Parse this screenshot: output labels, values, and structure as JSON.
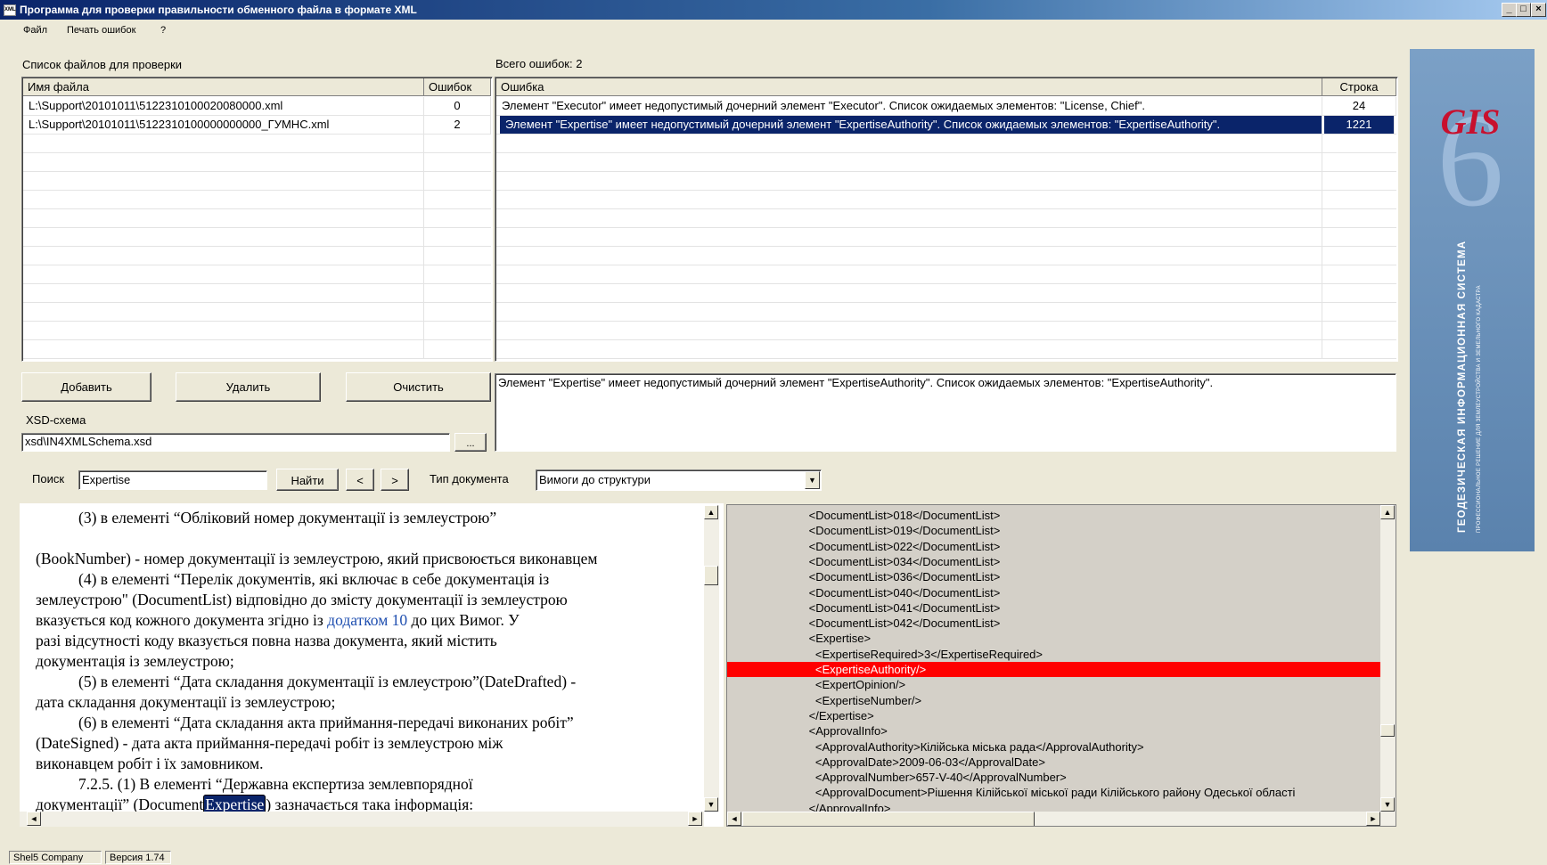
{
  "window": {
    "title": "Программа для проверки правильности обменного файла в формате XML",
    "icon_text": "XML",
    "controls": [
      "_",
      "□",
      "×"
    ]
  },
  "menu": [
    "Файл",
    "Печать ошибок",
    "?"
  ],
  "files_panel": {
    "label": "Список файлов для проверки",
    "columns": [
      "Имя файла",
      "Ошибок"
    ],
    "rows": [
      {
        "name": "L:\\Support\\20101011\\5122310100020080000.xml",
        "errors": "0"
      },
      {
        "name": "L:\\Support\\20101011\\5122310100000000000_ГУМНС.xml",
        "errors": "2"
      }
    ]
  },
  "errors_panel": {
    "label": "Всего ошибок: 2",
    "columns": [
      "Ошибка",
      "Строка"
    ],
    "rows": [
      {
        "message": "Элемент \"Executor\" имеет недопустимый дочерний элемент \"Executor\". Список ожидаемых элементов: \"License, Chief\".",
        "line": "24"
      },
      {
        "message": "Элемент \"Expertise\" имеет недопустимый дочерний элемент \"ExpertiseAuthority\". Список ожидаемых элементов: \"ExpertiseAuthority\".",
        "line": "1221"
      }
    ],
    "selected_index": 1
  },
  "buttons": {
    "add": "Добавить",
    "delete": "Удалить",
    "clear": "Очистить"
  },
  "error_detail": "Элемент \"Expertise\" имеет недопустимый дочерний элемент \"ExpertiseAuthority\". Список ожидаемых элементов: \"ExpertiseAuthority\".",
  "xsd": {
    "label": "XSD-схема",
    "value": "xsd\\IN4XMLSchema.xsd",
    "browse": "..."
  },
  "search": {
    "label": "Поиск",
    "value": "Expertise",
    "find_button": "Найти",
    "prev": "<",
    "next": ">",
    "doctype_label": "Тип документа",
    "doctype_value": "Вимоги до структури"
  },
  "document_text": {
    "l1": "(3) в елементі  “Обліковий  номер  документації  із  землеустрою”",
    "l2": "(BookNumber)   -   номер документації із землеустрою, який присвоюється виконавцем",
    "l3": "(4)  в  елементі  “Перелік  документів,  які  включає  в  себе  документація  із",
    "l4": "землеустрою\" (DocumentList) відповідно до змісту документації  із  землеустрою",
    "l5a": "вказується код кожного документа згідно із ",
    "l5link": "додатком 10",
    "l5b": "  до  цих  Вимог.  У",
    "l6": "разі   відсутності    коду    вказується   повна   назва   документа,    який   містить",
    "l7": "документація із землеустрою;",
    "l8": "(5) в елементі  “Дата  складання  документації  із  емлеустрою”(DateDrafted) -",
    "l9": "дата складання документації із землеустрою;",
    "l10": "(6)  в  елементі  “Дата складання акта приймання-передачі виконаних робіт”",
    "l11": "(DateSigned)   -   дата   акта   приймання-передачі   робіт   із   землеустрою  між",
    "l12": "виконавцем робіт і їх замовником.",
    "l13": "7.2.5.  (1) В   елементі   “Державна експертиза землевпорядної",
    "l14a": "документації” (Document",
    "l14hl": "Expertise",
    "l14b": ") зазначається така інформація:"
  },
  "xml_lines": [
    "      <DocumentList>018</DocumentList>",
    "      <DocumentList>019</DocumentList>",
    "      <DocumentList>022</DocumentList>",
    "      <DocumentList>034</DocumentList>",
    "      <DocumentList>036</DocumentList>",
    "      <DocumentList>040</DocumentList>",
    "      <DocumentList>041</DocumentList>",
    "      <DocumentList>042</DocumentList>",
    "      <Expertise>",
    "        <ExpertiseRequired>3</ExpertiseRequired>",
    "        <ExpertiseAuthority/>",
    "        <ExpertOpinion/>",
    "        <ExpertiseNumber/>",
    "      </Expertise>",
    "      <ApprovalInfo>",
    "        <ApprovalAuthority>Кілійська міська рада</ApprovalAuthority>",
    "        <ApprovalDate>2009-06-03</ApprovalDate>",
    "        <ApprovalNumber>657-V-40</ApprovalNumber>",
    "        <ApprovalDocument>Рішення Кілійської міської ради Кілійського району Одеської області",
    "      </ApprovalInfo>"
  ],
  "xml_error_index": 10,
  "logo": {
    "brand": "GIS",
    "digit": "6",
    "title": "ГЕОДЕЗИЧЕСКАЯ ИНФОРМАЦИОННАЯ СИСТЕМА",
    "subtitle": "ПРОФЕССИОНАЛЬНОЕ РЕШЕНИЕ ДЛЯ ЗЕМЛЕУСТРОЙСТВА И ЗЕМЕЛЬНОГО КАДАСТРА"
  },
  "status": {
    "company": "Shel5 Company",
    "version": "Версия 1.74"
  },
  "colors": {
    "titlebar": "#0a246a",
    "selection": "#0a246a",
    "error_line": "#ff0000",
    "logo_brand": "#c8102e"
  }
}
